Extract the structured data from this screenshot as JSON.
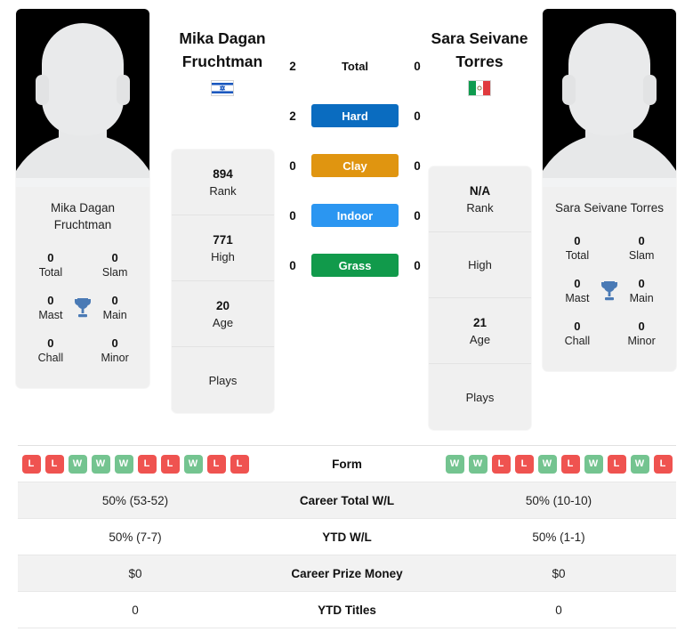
{
  "players": {
    "left": {
      "name_line1": "Mika Dagan",
      "name_line2": "Fruchtman",
      "card_name": "Mika Dagan Fruchtman",
      "country": "israel-flag",
      "avatar": "player-photo-placeholder",
      "titles": {
        "total_value": "0",
        "total_label": "Total",
        "slam_value": "0",
        "slam_label": "Slam",
        "mast_value": "0",
        "mast_label": "Mast",
        "main_value": "0",
        "main_label": "Main",
        "chall_value": "0",
        "chall_label": "Chall",
        "minor_value": "0",
        "minor_label": "Minor"
      },
      "stats": [
        {
          "value": "894",
          "label": "Rank"
        },
        {
          "value": "771",
          "label": "High"
        },
        {
          "value": "20",
          "label": "Age"
        },
        {
          "value": "",
          "label": "Plays"
        }
      ]
    },
    "right": {
      "name_line1": "Sara Seivane",
      "name_line2": "Torres",
      "card_name": "Sara Seivane Torres",
      "country": "mexico-flag",
      "avatar": "player-photo-placeholder",
      "titles": {
        "total_value": "0",
        "total_label": "Total",
        "slam_value": "0",
        "slam_label": "Slam",
        "mast_value": "0",
        "mast_label": "Mast",
        "main_value": "0",
        "main_label": "Main",
        "chall_value": "0",
        "chall_label": "Chall",
        "minor_value": "0",
        "minor_label": "Minor"
      },
      "stats": [
        {
          "value": "N/A",
          "label": "Rank"
        },
        {
          "value": "",
          "label": "High"
        },
        {
          "value": "21",
          "label": "Age"
        },
        {
          "value": "",
          "label": "Plays"
        }
      ]
    }
  },
  "surfaces": [
    {
      "label": "Total",
      "left": "2",
      "right": "0",
      "color": "",
      "style": "plain"
    },
    {
      "label": "Hard",
      "left": "2",
      "right": "0",
      "color": "#0a6cc0",
      "style": "pill"
    },
    {
      "label": "Clay",
      "left": "0",
      "right": "0",
      "color": "#e09510",
      "style": "pill"
    },
    {
      "label": "Indoor",
      "left": "0",
      "right": "0",
      "color": "#2b96f1",
      "style": "pill"
    },
    {
      "label": "Grass",
      "left": "0",
      "right": "0",
      "color": "#119a4b",
      "style": "pill"
    }
  ],
  "comparison": {
    "form": {
      "label": "Form",
      "left": [
        "L",
        "L",
        "W",
        "W",
        "W",
        "L",
        "L",
        "W",
        "L",
        "L"
      ],
      "right": [
        "W",
        "W",
        "L",
        "L",
        "W",
        "L",
        "W",
        "L",
        "W",
        "L"
      ]
    },
    "rows": [
      {
        "label": "Career Total W/L",
        "left": "50% (53-52)",
        "right": "50% (10-10)"
      },
      {
        "label": "YTD W/L",
        "left": "50% (7-7)",
        "right": "50% (1-1)"
      },
      {
        "label": "Career Prize Money",
        "left": "$0",
        "right": "$0"
      },
      {
        "label": "YTD Titles",
        "left": "0",
        "right": "0"
      }
    ]
  },
  "theme": {
    "win_color": "#74c490",
    "loss_color": "#ef5350",
    "trophy_color": "#4a7ab5"
  }
}
